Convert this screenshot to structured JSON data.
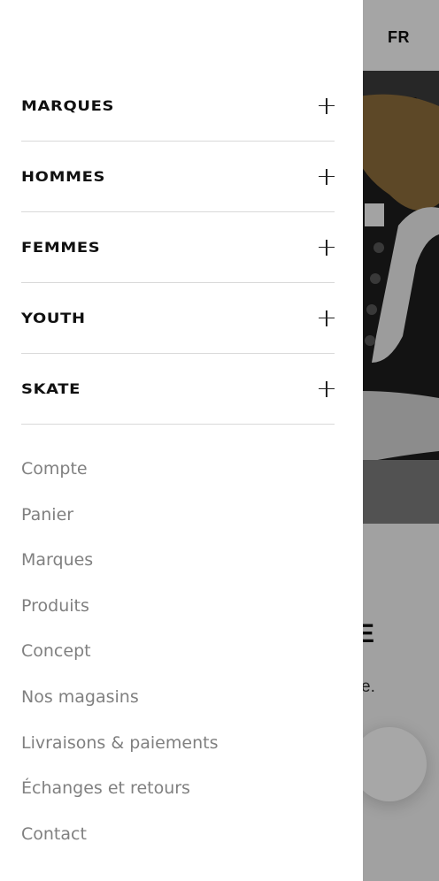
{
  "language": {
    "current": "FR"
  },
  "menu": {
    "categories": [
      {
        "label": "MARQUES"
      },
      {
        "label": "HOMMES"
      },
      {
        "label": "FEMMES"
      },
      {
        "label": "YOUTH"
      },
      {
        "label": "SKATE"
      }
    ],
    "links": [
      {
        "label": "Compte"
      },
      {
        "label": "Panier"
      },
      {
        "label": "Marques"
      },
      {
        "label": "Produits"
      },
      {
        "label": "Concept"
      },
      {
        "label": "Nos magasins"
      },
      {
        "label": "Livraisons & paiements"
      },
      {
        "label": "Échanges et retours"
      },
      {
        "label": "Contact"
      }
    ]
  },
  "background": {
    "partial_heading": "E",
    "partial_text": "e."
  },
  "colors": {
    "drawer_bg": "#ffffff",
    "category_text": "#111111",
    "link_text": "#808080",
    "divider": "#d9d9d9"
  },
  "icons": {
    "expand": "plus-icon",
    "chat": "chat-bubble"
  }
}
